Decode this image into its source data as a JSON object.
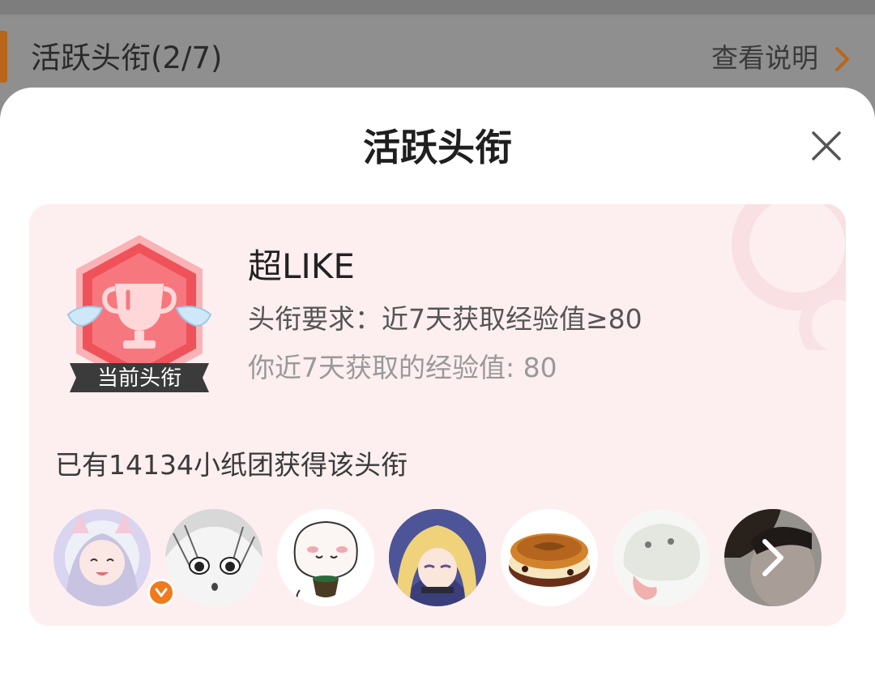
{
  "background": {
    "section_title": "活跃头衔(2/7)",
    "view_explanation": "查看说明",
    "accent_color": "#b8661c"
  },
  "sheet": {
    "title": "活跃头衔",
    "close_icon": "close-icon"
  },
  "badge": {
    "icon": "trophy-badge-icon",
    "ribbon_label": "当前头衔",
    "name": "超LIKE",
    "requirement": "头衔要求：近7天获取经验值≥80",
    "your_exp": "你近7天获取的经验值: 80"
  },
  "holders": {
    "count_text": "已有14134小纸团获得该头衔",
    "avatars": [
      {
        "name": "avatar-anime-bunny-girl",
        "verified": true
      },
      {
        "name": "avatar-manga-sketch-girl",
        "verified": false
      },
      {
        "name": "avatar-cartoon-teacup",
        "verified": false
      },
      {
        "name": "avatar-anime-blonde-girl",
        "verified": false
      },
      {
        "name": "avatar-pancake",
        "verified": false
      },
      {
        "name": "avatar-plush-creature",
        "verified": false
      },
      {
        "name": "avatar-person-photo",
        "verified": false
      }
    ],
    "more_icon": "chevron-right-icon"
  },
  "colors": {
    "card_background": "#fdeff0",
    "badge_red": "#f0525a",
    "verified_orange": "#f07a1c"
  }
}
